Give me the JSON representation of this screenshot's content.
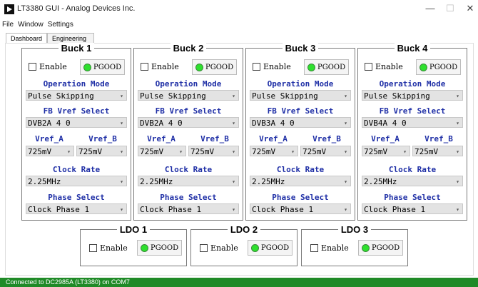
{
  "window": {
    "title": "LT3380 GUI - Analog Devices Inc.",
    "minimize": "—",
    "maximize": "☐",
    "close": "✕"
  },
  "menu": [
    "File",
    "Window",
    "Settings"
  ],
  "tabs": [
    {
      "label": "Dashboard",
      "active": true
    },
    {
      "label": "Engineering",
      "active": false
    }
  ],
  "bucks": [
    {
      "title": "Buck 1",
      "enable": "Enable",
      "pgood": "PGOOD",
      "op_label": "Operation Mode",
      "op_value": "Pulse_Skipping",
      "fb_label": "FB Vref Select",
      "fb_value": "DVB2A_4_0",
      "vref_a_label": "Vref_A",
      "vref_b_label": "Vref_B",
      "vref_a_value": "725mV",
      "vref_b_value": "725mV",
      "clk_label": "Clock Rate",
      "clk_value": "2.25MHz",
      "phase_label": "Phase Select",
      "phase_value": "Clock_Phase_1"
    },
    {
      "title": "Buck 2",
      "enable": "Enable",
      "pgood": "PGOOD",
      "op_label": "Operation Mode",
      "op_value": "Pulse_Skipping",
      "fb_label": "FB Vref Select",
      "fb_value": "DVB2A_4_0",
      "vref_a_label": "Vref_A",
      "vref_b_label": "Vref_B",
      "vref_a_value": "725mV",
      "vref_b_value": "725mV",
      "clk_label": "Clock Rate",
      "clk_value": "2.25MHz",
      "phase_label": "Phase Select",
      "phase_value": "Clock_Phase_1"
    },
    {
      "title": "Buck 3",
      "enable": "Enable",
      "pgood": "PGOOD",
      "op_label": "Operation Mode",
      "op_value": "Pulse_Skipping",
      "fb_label": "FB Vref Select",
      "fb_value": "DVB3A_4_0",
      "vref_a_label": "Vref_A",
      "vref_b_label": "Vref_B",
      "vref_a_value": "725mV",
      "vref_b_value": "725mV",
      "clk_label": "Clock Rate",
      "clk_value": "2.25MHz",
      "phase_label": "Phase Select",
      "phase_value": "Clock_Phase_1"
    },
    {
      "title": "Buck 4",
      "enable": "Enable",
      "pgood": "PGOOD",
      "op_label": "Operation Mode",
      "op_value": "Pulse_Skipping",
      "fb_label": "FB Vref Select",
      "fb_value": "DVB4A_4_0",
      "vref_a_label": "Vref_A",
      "vref_b_label": "Vref_B",
      "vref_a_value": "725mV",
      "vref_b_value": "725mV",
      "clk_label": "Clock Rate",
      "clk_value": "2.25MHz",
      "phase_label": "Phase Select",
      "phase_value": "Clock_Phase_1"
    }
  ],
  "ldos": [
    {
      "title": "LDO 1",
      "enable": "Enable",
      "pgood": "PGOOD"
    },
    {
      "title": "LDO 2",
      "enable": "Enable",
      "pgood": "PGOOD"
    },
    {
      "title": "LDO 3",
      "enable": "Enable",
      "pgood": "PGOOD"
    }
  ],
  "status_bar": "Connected to DC2985A (LT3380) on COM7",
  "colors": {
    "label_blue": "#1f2fa6",
    "status_green": "#1f8a27",
    "led_green": "#2ee02e"
  }
}
